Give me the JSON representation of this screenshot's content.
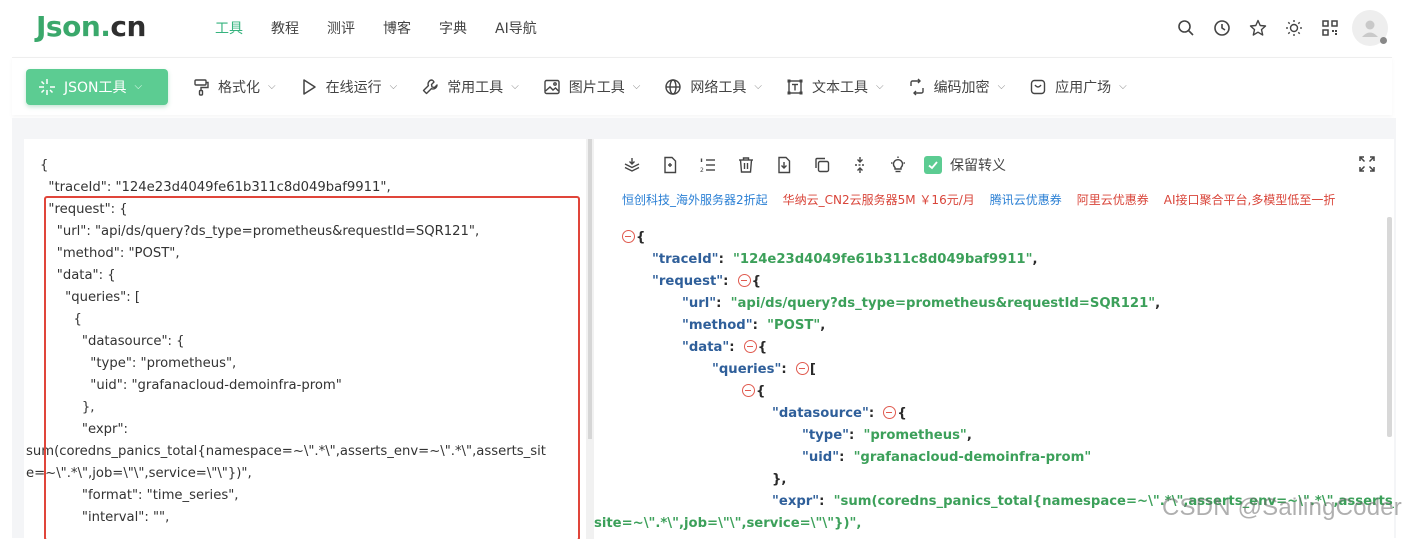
{
  "brand": {
    "name_main": "Json",
    "name_dot": ".",
    "name_cn": "cn"
  },
  "nav": {
    "items": [
      {
        "label": "工具",
        "active": true
      },
      {
        "label": "教程",
        "active": false
      },
      {
        "label": "测评",
        "active": false
      },
      {
        "label": "博客",
        "active": false
      },
      {
        "label": "字典",
        "active": false
      },
      {
        "label": "AI导航",
        "active": false
      }
    ]
  },
  "top_icons": [
    "search-icon",
    "history-icon",
    "star-icon",
    "theme-icon",
    "qrcode-icon",
    "user-avatar"
  ],
  "toolbar": {
    "items": [
      {
        "label": "JSON工具",
        "icon": "sparkle-icon",
        "primary": true
      },
      {
        "label": "格式化",
        "icon": "brush-icon"
      },
      {
        "label": "在线运行",
        "icon": "play-icon"
      },
      {
        "label": "常用工具",
        "icon": "wrench-icon"
      },
      {
        "label": "图片工具",
        "icon": "image-icon"
      },
      {
        "label": "网络工具",
        "icon": "globe-icon"
      },
      {
        "label": "文本工具",
        "icon": "text-box-icon"
      },
      {
        "label": "编码加密",
        "icon": "swap-icon"
      },
      {
        "label": "应用广场",
        "icon": "app-icon"
      }
    ]
  },
  "left_editor": {
    "lines": [
      "{",
      "  \"traceId\": \"124e23d4049fe61b311c8d049baf9911\",",
      "  \"request\": {",
      "    \"url\": \"api/ds/query?ds_type=prometheus&requestId=SQR121\",",
      "    \"method\": \"POST\",",
      "    \"data\": {",
      "      \"queries\": [",
      "        {",
      "          \"datasource\": {",
      "            \"type\": \"prometheus\",",
      "            \"uid\": \"grafanacloud-demoinfra-prom\"",
      "          },",
      "          \"expr\":",
      "sum(coredns_panics_total{namespace=~\\\".*\\\",asserts_env=~\\\".*\\\",asserts_sit",
      "e=~\\\".*\\\",job=\\\"\\\",service=\\\"\\\"})\",",
      "          \"format\": \"time_series\",",
      "          \"interval\": \"\","
    ]
  },
  "right_panel": {
    "keep_escape_label": "保留转义",
    "keep_escape_checked": true,
    "ads": [
      {
        "text": "恒创科技_海外服务器2折起",
        "color": "blue"
      },
      {
        "text": "华纳云_CN2云服务器5M ￥16元/月",
        "color": "red"
      },
      {
        "text": "腾讯云优惠券",
        "color": "blue"
      },
      {
        "text": "阿里云优惠券",
        "color": "red"
      },
      {
        "text": "AI接口聚合平台,多模型低至一折",
        "color": "red"
      }
    ],
    "tree": {
      "root_open": "{",
      "traceId_key": "\"traceId\"",
      "traceId_val": "\"124e23d4049fe61b311c8d049baf9911\"",
      "request_key": "\"request\"",
      "url_key": "\"url\"",
      "url_val": "\"api/ds/query?ds_type=prometheus&requestId=SQR121\"",
      "method_key": "\"method\"",
      "method_val": "\"POST\"",
      "data_key": "\"data\"",
      "queries_key": "\"queries\"",
      "datasource_key": "\"datasource\"",
      "type_key": "\"type\"",
      "type_val": "\"prometheus\"",
      "uid_key": "\"uid\"",
      "uid_val": "\"grafanacloud-demoinfra-prom\"",
      "close_obj": "},",
      "expr_key": "\"expr\"",
      "expr_val_1": "\"sum(coredns_panics_total{namespace=~\\\".*\\\",asserts_env=~\\\".*\\\",asserts_",
      "expr_val_2": "site=~\\\".*\\\",job=\\\"\\\",service=\\\"\\\"})\","
    }
  },
  "watermark": "CSDN @SailingCoder"
}
